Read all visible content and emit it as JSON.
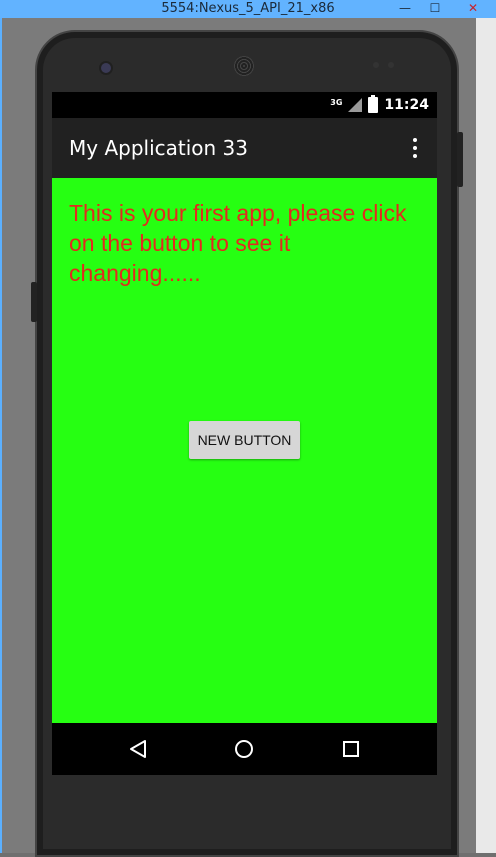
{
  "window": {
    "title": "5554:Nexus_5_API_21_x86",
    "minimize_glyph": "—",
    "maximize_glyph": "☐",
    "close_glyph": "✕"
  },
  "status_bar": {
    "network": "3G",
    "time": "11:24",
    "icons": [
      "signal-icon",
      "battery-icon"
    ]
  },
  "app_bar": {
    "title": "My Application 33",
    "menu_icon": "overflow-menu-icon"
  },
  "content": {
    "message": "This is your first app, please click on the button to see it changing......",
    "button_label": "NEW BUTTON",
    "background_color": "#26ff12",
    "text_color": "#e32a1f"
  },
  "nav_bar": {
    "items": [
      "back-icon",
      "home-icon",
      "recents-icon"
    ]
  }
}
